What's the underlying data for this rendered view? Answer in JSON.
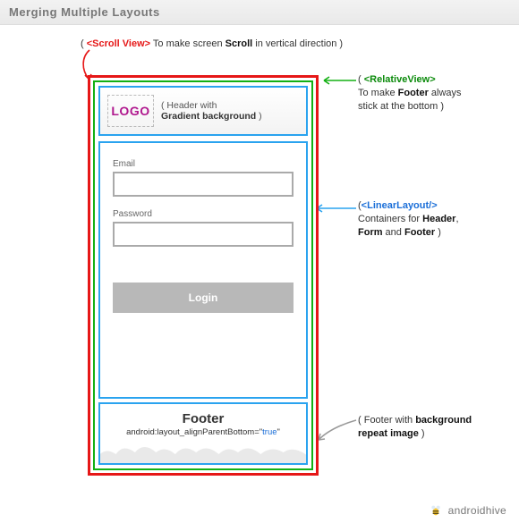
{
  "title": "Merging Multiple Layouts",
  "annotations": {
    "scroll": {
      "tag": "<Scroll View>",
      "text_pre": "( ",
      "text_post": " To make screen ",
      "bold": "Scroll",
      "text_tail": " in vertical direction )"
    },
    "relative": {
      "tag": "<RelativeView>",
      "line1_pre": "( ",
      "line2a": "To make ",
      "line2b": "Footer",
      "line2c": " always",
      "line3": "stick at the bottom )"
    },
    "linear": {
      "tag": "<LinearLayout/>",
      "pre": "(",
      "line2a": "Containers for ",
      "h": "Header",
      "comma": ",",
      "f": "Form",
      "and": " and ",
      "ft": "Footer",
      "tail": " )"
    },
    "footer": {
      "pre": "( Footer with ",
      "b1": "background",
      "b2": "repeat image",
      "tail": " )"
    }
  },
  "phone": {
    "header": {
      "logo": "LOGO",
      "desc_pre": "( Header with",
      "desc_bold": "Gradient background",
      "desc_post": " )"
    },
    "form": {
      "email_label": "Email",
      "password_label": "Password",
      "login": "Login"
    },
    "footer": {
      "title": "Footer",
      "attr_pre": "android:layout_alignParentBottom=\"",
      "attr_val": "true",
      "attr_post": "\""
    }
  },
  "brand": {
    "name": "androidhive"
  }
}
